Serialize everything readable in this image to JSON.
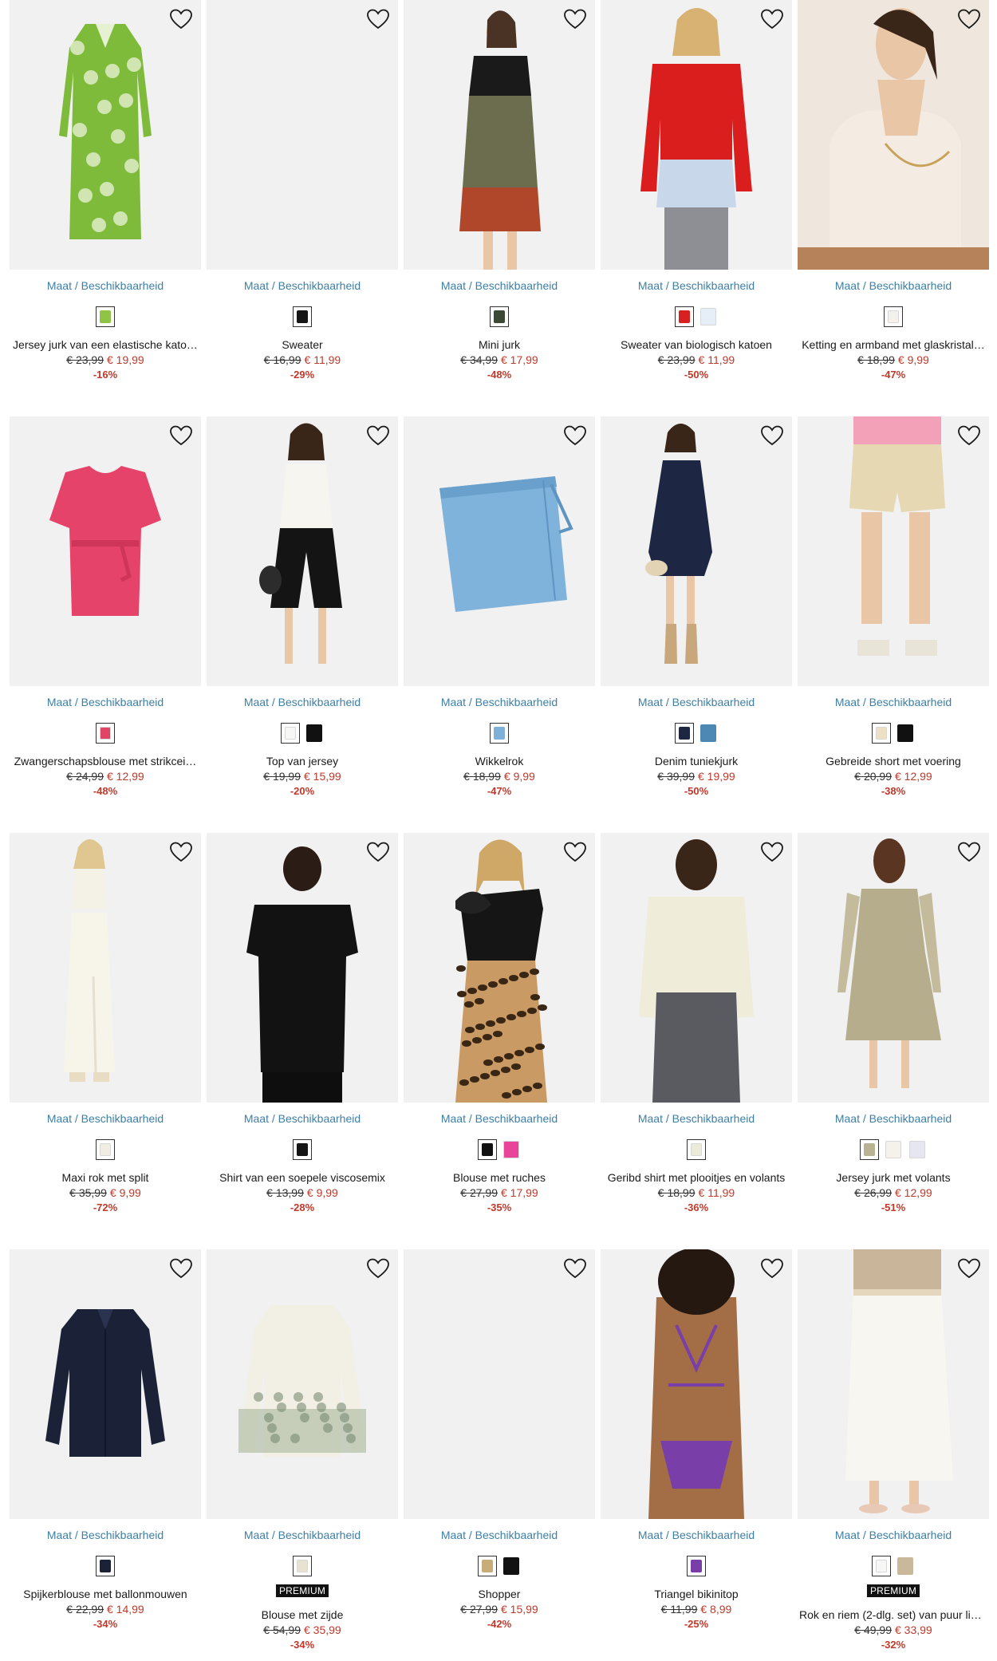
{
  "size_link_label": "Maat / Beschikbaarheid",
  "favorite_icon": "heart-outline-icon",
  "products": [
    {
      "name": "Jersey jurk van een elastische kato…",
      "old": "€ 23,99",
      "new": "€ 19,99",
      "disc": "-16%",
      "badge": "",
      "swatches": [
        "#8fc447"
      ],
      "img": "dress-green"
    },
    {
      "name": "Sweater",
      "old": "€ 16,99",
      "new": "€ 11,99",
      "disc": "-29%",
      "badge": "",
      "swatches": [
        "#151515"
      ],
      "img": "blank"
    },
    {
      "name": "Mini jurk",
      "old": "€ 34,99",
      "new": "€ 17,99",
      "disc": "-48%",
      "badge": "",
      "swatches": [
        "#3c4a35"
      ],
      "img": "dress-color"
    },
    {
      "name": "Sweater van biologisch katoen",
      "old": "€ 23,99",
      "new": "€ 11,99",
      "disc": "-50%",
      "badge": "",
      "swatches": [
        "#d92020",
        "#e6eef8"
      ],
      "img": "sweater-red"
    },
    {
      "name": "Ketting en armband met glaskristal…",
      "old": "€ 18,99",
      "new": "€ 9,99",
      "disc": "-47%",
      "badge": "",
      "swatches": [
        "#f4f1ec"
      ],
      "img": "jewel"
    },
    {
      "name": "Zwangerschapsblouse met strikcei…",
      "old": "€ 24,99",
      "new": "€ 12,99",
      "disc": "-48%",
      "badge": "",
      "swatches": [
        "#e04565"
      ],
      "img": "blouse-pink"
    },
    {
      "name": "Top van jersey",
      "old": "€ 19,99",
      "new": "€ 15,99",
      "disc": "-20%",
      "badge": "",
      "swatches": [
        "#f7f7f5",
        "#111111"
      ],
      "img": "top-white"
    },
    {
      "name": "Wikkelrok",
      "old": "€ 18,99",
      "new": "€ 9,99",
      "disc": "-47%",
      "badge": "",
      "swatches": [
        "#7eb0d8"
      ],
      "img": "skirt-denim"
    },
    {
      "name": "Denim tuniekjurk",
      "old": "€ 39,99",
      "new": "€ 19,99",
      "disc": "-50%",
      "badge": "",
      "swatches": [
        "#1d2744",
        "#4d88b5"
      ],
      "img": "tunic-navy"
    },
    {
      "name": "Gebreide short met voering",
      "old": "€ 20,99",
      "new": "€ 12,99",
      "disc": "-38%",
      "badge": "",
      "swatches": [
        "#ede0c4",
        "#111111"
      ],
      "img": "short-knit"
    },
    {
      "name": "Maxi rok met split",
      "old": "€ 35,99",
      "new": "€ 9,99",
      "disc": "-72%",
      "badge": "",
      "swatches": [
        "#f1ede2"
      ],
      "img": "maxi-white"
    },
    {
      "name": "Shirt van een soepele viscosemix",
      "old": "€ 13,99",
      "new": "€ 9,99",
      "disc": "-28%",
      "badge": "",
      "swatches": [
        "#151515"
      ],
      "img": "shirt-black"
    },
    {
      "name": "Blouse met ruches",
      "old": "€ 27,99",
      "new": "€ 17,99",
      "disc": "-35%",
      "badge": "",
      "swatches": [
        "#111111",
        "#e8459a"
      ],
      "img": "ruffle-black"
    },
    {
      "name": "Geribd shirt met plooitjes en volants",
      "old": "€ 18,99",
      "new": "€ 11,99",
      "disc": "-36%",
      "badge": "",
      "swatches": [
        "#ecebd7"
      ],
      "img": "ribbed-cream"
    },
    {
      "name": "Jersey jurk met volants",
      "old": "€ 26,99",
      "new": "€ 12,99",
      "disc": "-51%",
      "badge": "",
      "swatches": [
        "#b9b293",
        "#f4f2ea",
        "#e5e6f2"
      ],
      "img": "dress-olive"
    },
    {
      "name": "Spijkerblouse met ballonmouwen",
      "old": "€ 22,99",
      "new": "€ 14,99",
      "disc": "-34%",
      "badge": "",
      "swatches": [
        "#1b2238"
      ],
      "img": "denim-blouse"
    },
    {
      "name": "Blouse met zijde",
      "old": "€ 54,99",
      "new": "€ 35,99",
      "disc": "-34%",
      "badge": "PREMIUM",
      "swatches": [
        "#e8e2d2"
      ],
      "img": "silk-blouse"
    },
    {
      "name": "Shopper",
      "old": "€ 27,99",
      "new": "€ 15,99",
      "disc": "-42%",
      "badge": "",
      "swatches": [
        "#c8ad7a",
        "#111111"
      ],
      "img": "blank"
    },
    {
      "name": "Triangel bikinitop",
      "old": "€ 11,99",
      "new": "€ 8,99",
      "disc": "-25%",
      "badge": "",
      "swatches": [
        "#7a3ea8"
      ],
      "img": "bikini"
    },
    {
      "name": "Rok en riem (2-dlg. set) van puur lin…",
      "old": "€ 49,99",
      "new": "€ 33,99",
      "disc": "-32%",
      "badge": "PREMIUM",
      "swatches": [
        "#f7f7f5",
        "#c9b89a"
      ],
      "img": "linen-skirt"
    }
  ]
}
